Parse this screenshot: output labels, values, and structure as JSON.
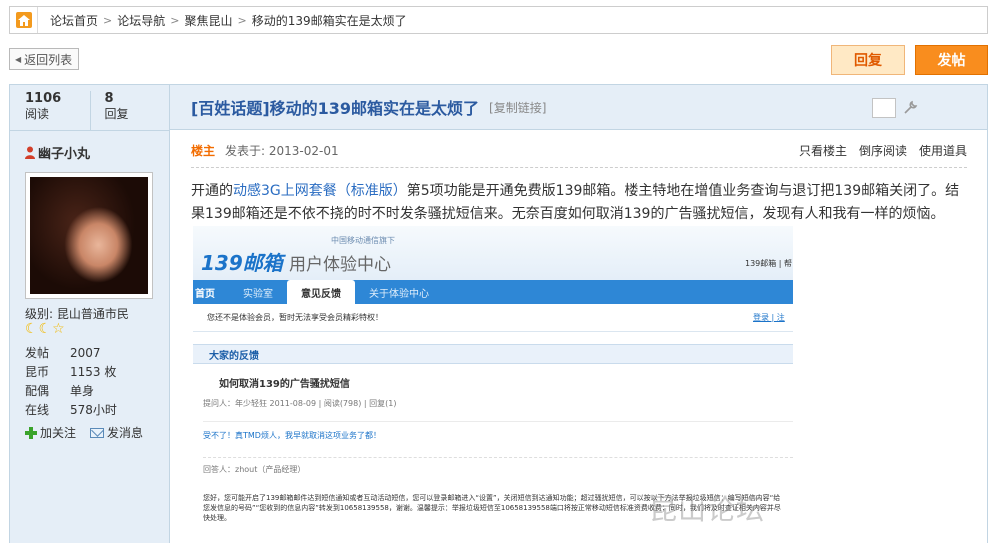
{
  "breadcrumb": {
    "items": [
      "论坛首页",
      "论坛导航",
      "聚焦昆山",
      "移动的139邮箱实在是太烦了"
    ],
    "separator": ">"
  },
  "toolbar": {
    "back_label": "返回列表",
    "reply_label": "回复",
    "post_label": "发帖"
  },
  "stats": {
    "views": "1106",
    "views_label": "阅读",
    "replies": "8",
    "replies_label": "回复"
  },
  "thread": {
    "title": "[百姓话题]移动的139邮箱实在是太烦了",
    "copy_link": "[复制链接]"
  },
  "author": {
    "name": "幽子小丸",
    "level": "级别: 昆山普通市民",
    "profile": [
      {
        "key": "发帖",
        "value": "2007"
      },
      {
        "key": "昆币",
        "value": "1153 枚"
      },
      {
        "key": "配偶",
        "value": "单身"
      },
      {
        "key": "在线",
        "value": "578小时"
      }
    ],
    "follow_label": "加关注",
    "message_label": "发消息"
  },
  "post": {
    "floor": "楼主",
    "time": "发表于: 2013-02-01",
    "tools": [
      "只看楼主",
      "倒序阅读",
      "使用道具"
    ],
    "body_pre": "开通的",
    "body_link": "动感3G上网套餐（标准版）",
    "body_post": "第5项功能是开通免费版139邮箱。楼主特地在增值业务查询与退订把139邮箱关闭了。结果139邮箱还是不依不挠的时不时发条骚扰短信来。无奈百度如何取消139的广告骚扰短信，发现有人和我有一样的烦恼。"
  },
  "screenshot": {
    "small_caption": "中国移动通信旗下",
    "logo": "139邮箱",
    "logo_sub": "用户体验中心",
    "right_text": "139邮箱 | 帮",
    "tabs": [
      "首页",
      "实验室",
      "意见反馈",
      "关于体验中心"
    ],
    "active_tab": "意见反馈",
    "notice": "您还不是体验会员，暂时无法享受会员精彩特权！",
    "login": "登录 | 注",
    "section": "大家的反馈",
    "question": "如何取消139的广告骚扰短信",
    "question_meta": "提问人：年少轻狂   2011-08-09  |  阅读(798)  |  回复(1)",
    "reply1": "受不了！真TMD烦人，我早就取消这项业务了都！",
    "reply_by": "回答人：zhout（产品经理）",
    "answer_text": "您好，您可能开启了139邮箱邮件达到短信通知或者互动活动短信，您可以登录邮箱进入“设置”，关闭短信到达通知功能；超过骚扰短信，可以按以下方法举报垃圾短信：编写短信内容“给您发信息的号码”“您收到的信息内容”转发到10658139558，谢谢。温馨提示：举报垃圾短信至10658139558端口将按正常移动短信标准资费收费；同时，我们将及时查证相关内容并尽快处理。",
    "watermark": "昆山论坛 BBS"
  },
  "colors": {
    "accent_orange": "#f98d1e",
    "title_blue": "#2b5aa0",
    "panel_blue": "#e5eef7"
  }
}
